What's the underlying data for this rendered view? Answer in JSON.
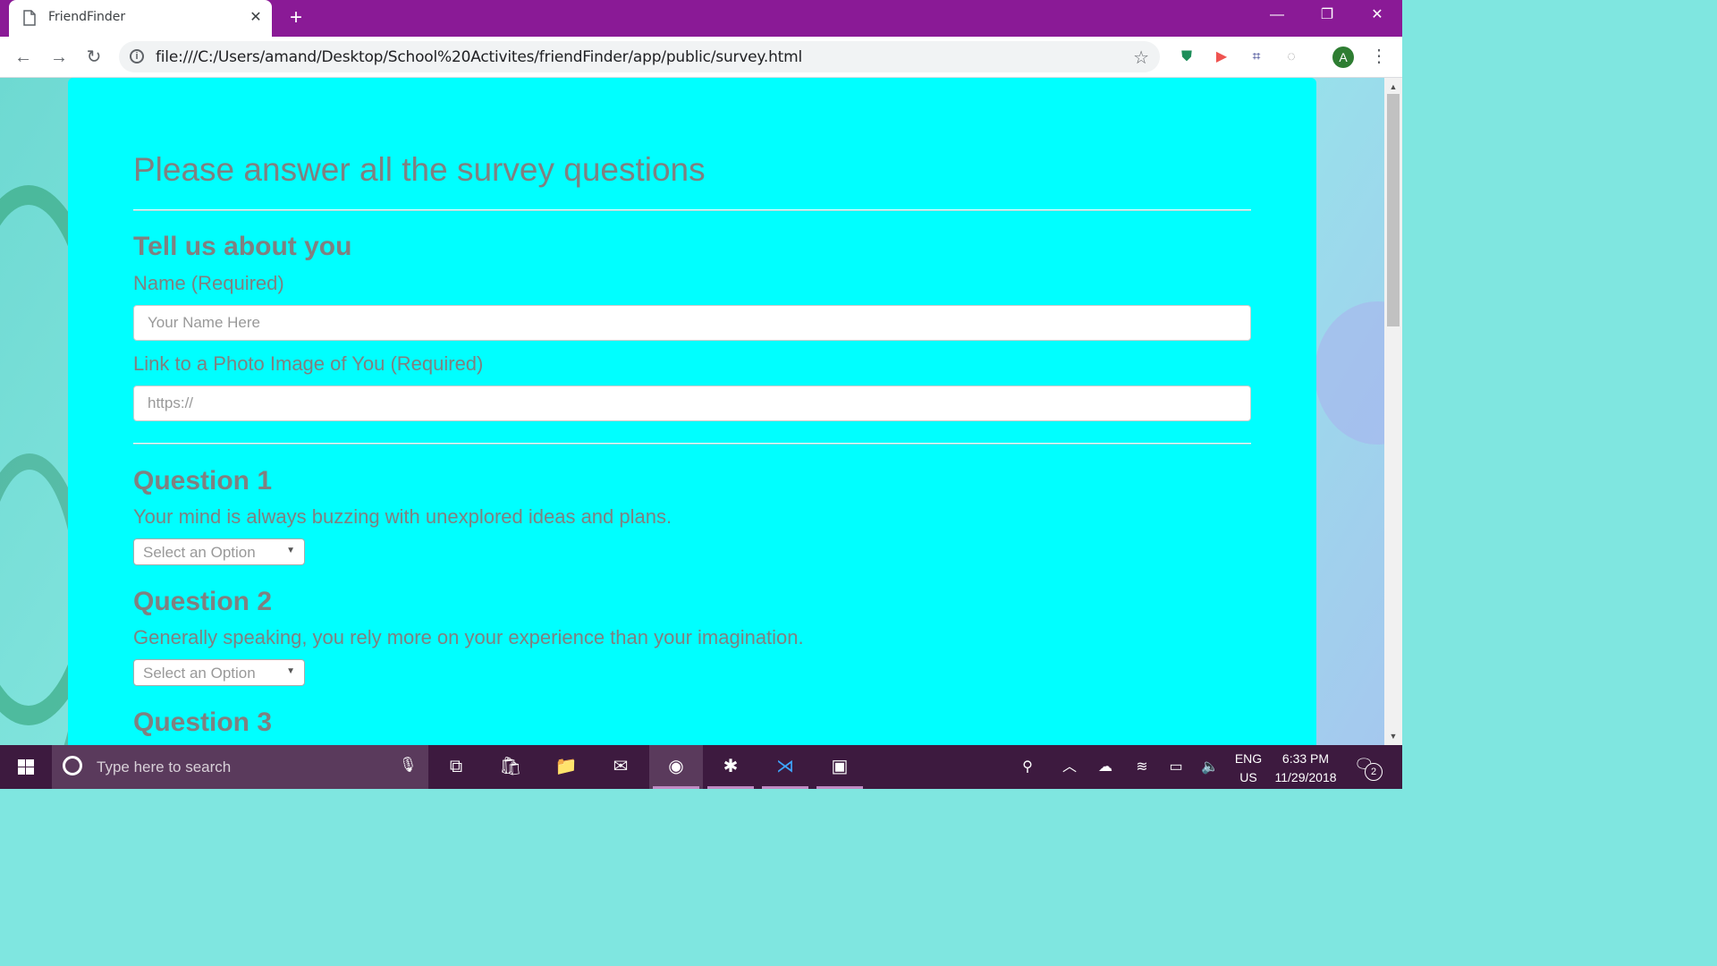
{
  "browser": {
    "tab_title": "FriendFinder",
    "url": "file:///C:/Users/amand/Desktop/School%20Activites/friendFinder/app/public/survey.html",
    "profile_initial": "A"
  },
  "page": {
    "title": "Please answer all the survey questions",
    "about_heading": "Tell us about you",
    "name_label": "Name (Required)",
    "name_placeholder": "Your Name Here",
    "photo_label": "Link to a Photo Image of You (Required)",
    "photo_placeholder": "https://",
    "questions": [
      {
        "heading": "Question 1",
        "text": "Your mind is always buzzing with unexplored ideas and plans.",
        "select": "Select an Option"
      },
      {
        "heading": "Question 2",
        "text": "Generally speaking, you rely more on your experience than your imagination.",
        "select": "Select an Option"
      },
      {
        "heading": "Question 3"
      }
    ]
  },
  "taskbar": {
    "search_placeholder": "Type here to search",
    "lang_top": "ENG",
    "lang_bottom": "US",
    "time": "6:33 PM",
    "date": "11/29/2018",
    "notification_count": "2"
  },
  "colors": {
    "tabstrip": "#8a1a96",
    "panel": "#00ffff",
    "text": "#808080",
    "taskbar": "#3d1a3f"
  }
}
